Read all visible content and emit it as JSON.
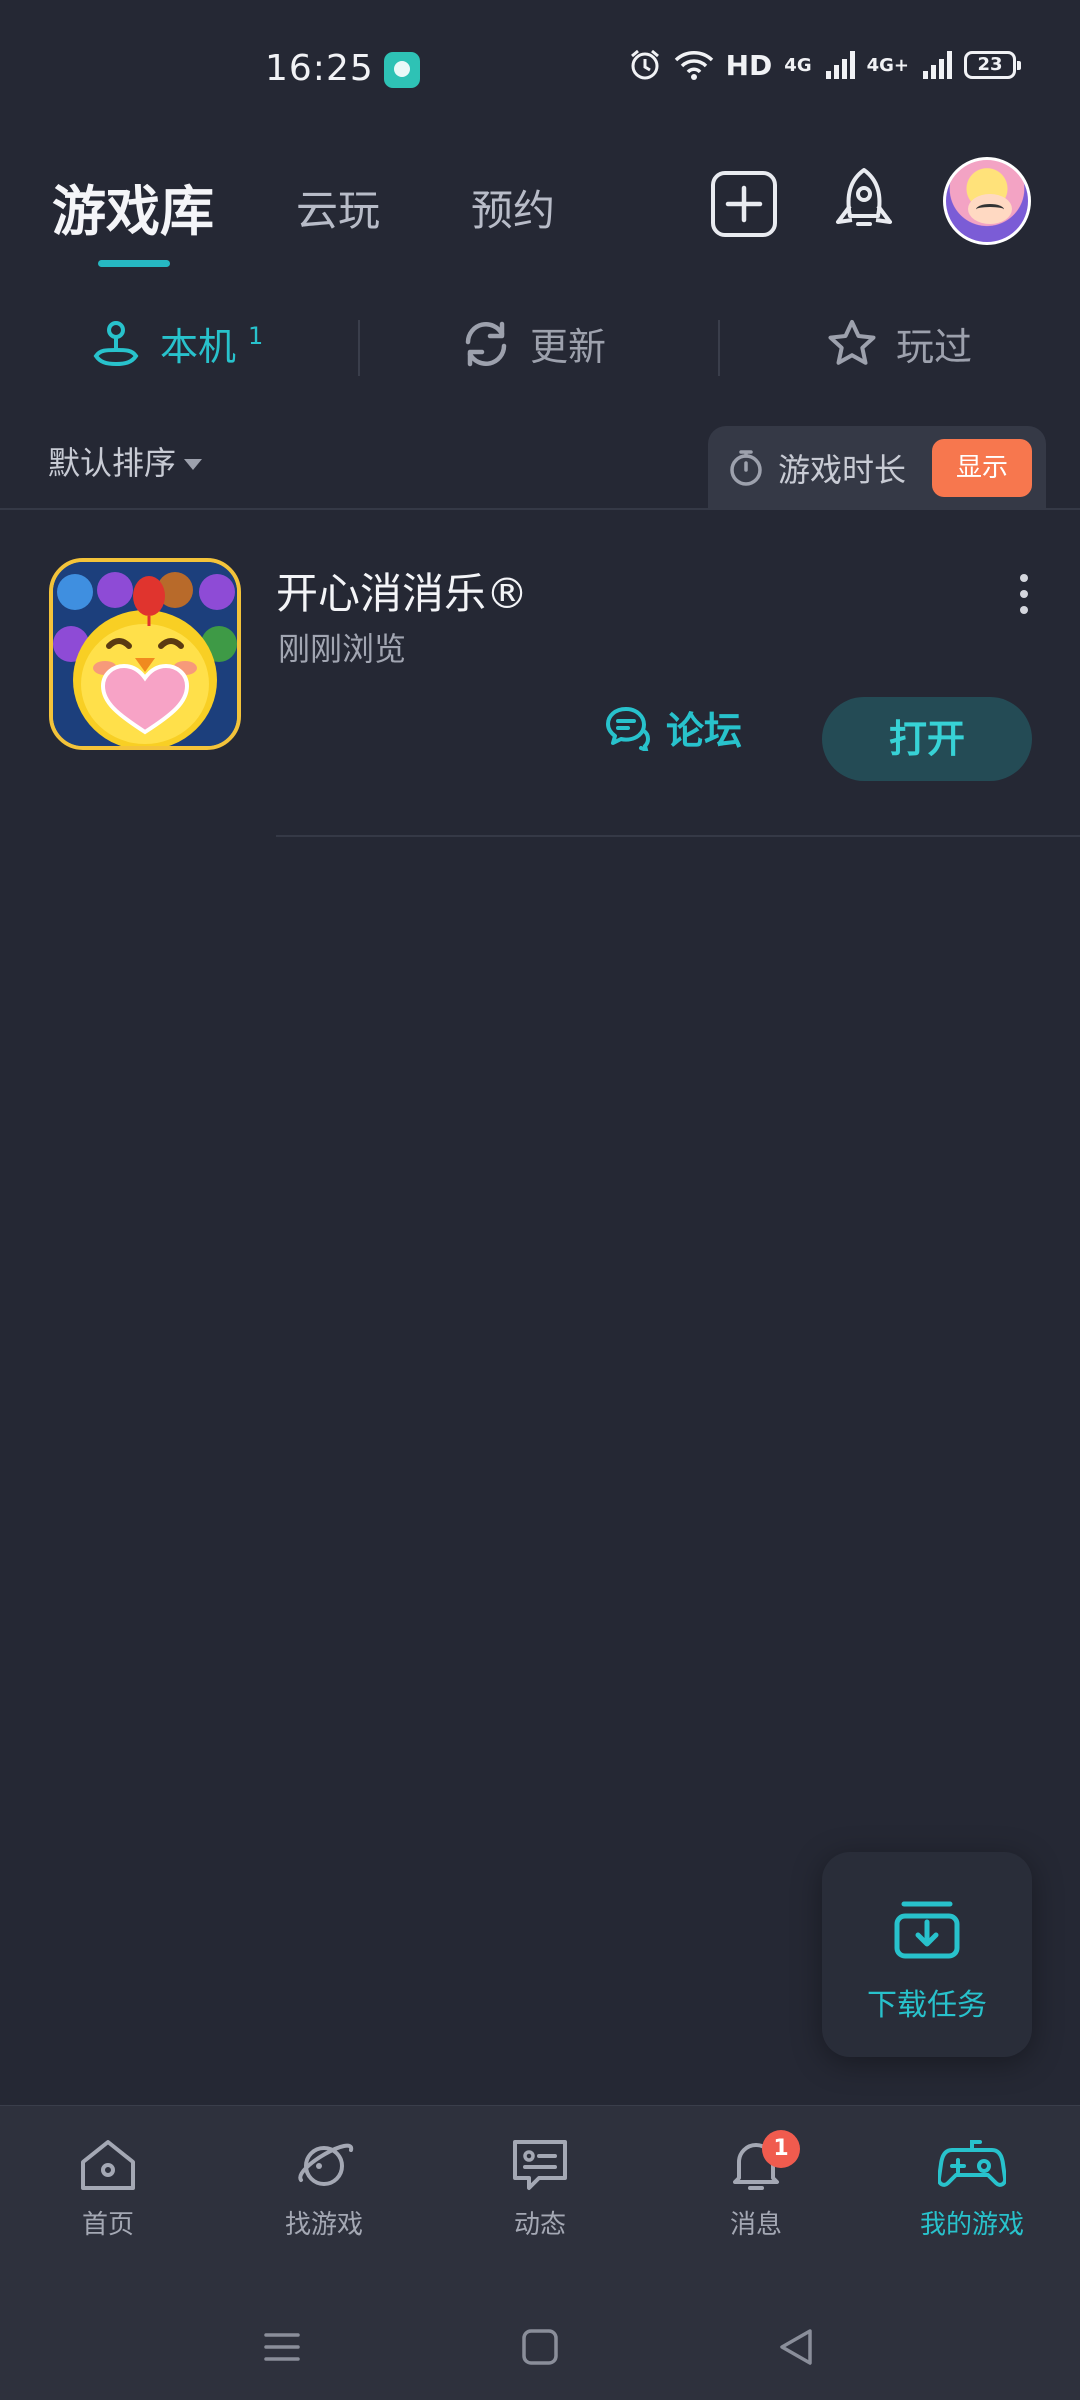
{
  "status_bar": {
    "time": "16:25",
    "hd": "HD",
    "net1": "4G",
    "net2": "4G+",
    "battery": "23"
  },
  "header": {
    "tabs": [
      "游戏库",
      "云玩",
      "预约"
    ],
    "active_tab": "游戏库"
  },
  "filters": {
    "items": [
      {
        "label": "本机",
        "count": "1",
        "icon": "joystick-icon"
      },
      {
        "label": "更新",
        "icon": "refresh-icon"
      },
      {
        "label": "玩过",
        "icon": "star-icon"
      }
    ]
  },
  "sort": {
    "label": "默认排序",
    "playtime_label": "游戏时长",
    "show_label": "显示"
  },
  "games": [
    {
      "name": "开心消消乐®",
      "subtitle": "刚刚浏览",
      "forum_label": "论坛",
      "open_label": "打开"
    }
  ],
  "fab": {
    "label": "下载任务"
  },
  "bottom_nav": {
    "items": [
      {
        "label": "首页",
        "icon": "home-icon"
      },
      {
        "label": "找游戏",
        "icon": "planet-icon"
      },
      {
        "label": "动态",
        "icon": "message-icon"
      },
      {
        "label": "消息",
        "icon": "bell-icon",
        "badge": "1"
      },
      {
        "label": "我的游戏",
        "icon": "gamepad-icon"
      }
    ],
    "active": "我的游戏"
  },
  "colors": {
    "background": "#252834",
    "accent": "#28c2cc",
    "orange": "#f7774e",
    "badge": "#f05b4e"
  }
}
